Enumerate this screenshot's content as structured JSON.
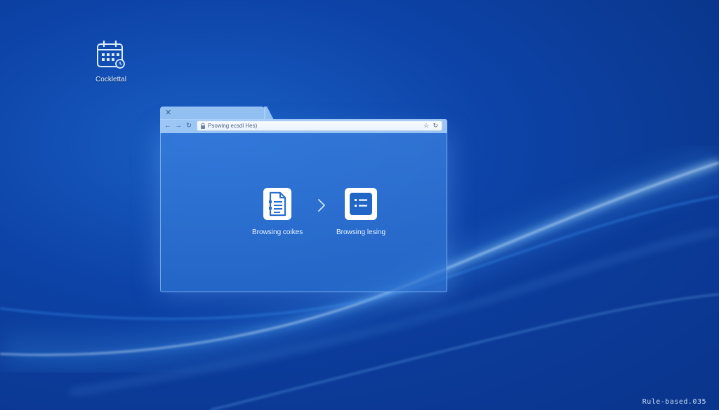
{
  "desktop": {
    "icon": {
      "name": "calendar-icon",
      "label": "Cocklettal"
    }
  },
  "browser": {
    "tab": {
      "close_glyph": "✕"
    },
    "toolbar": {
      "back_glyph": "←",
      "forward_glyph": "→",
      "refresh_glyph": "↻",
      "address_text": "Psowing ecsdl Hes)",
      "star_glyph": "☆",
      "reload_glyph": "↻"
    },
    "content": {
      "flow": [
        {
          "icon": "document-list-icon",
          "label": "Browsing coikes"
        },
        {
          "icon": "list-icon",
          "label": "Browsing lesing"
        }
      ],
      "arrow_icon": "chevron-right-icon"
    }
  },
  "watermark": "Rule-based.035",
  "colors": {
    "wallpaper_dark": "#08307f",
    "wallpaper_mid": "#0d43a8",
    "accent_light": "#aad2fa",
    "icon_white": "#ffffff"
  }
}
